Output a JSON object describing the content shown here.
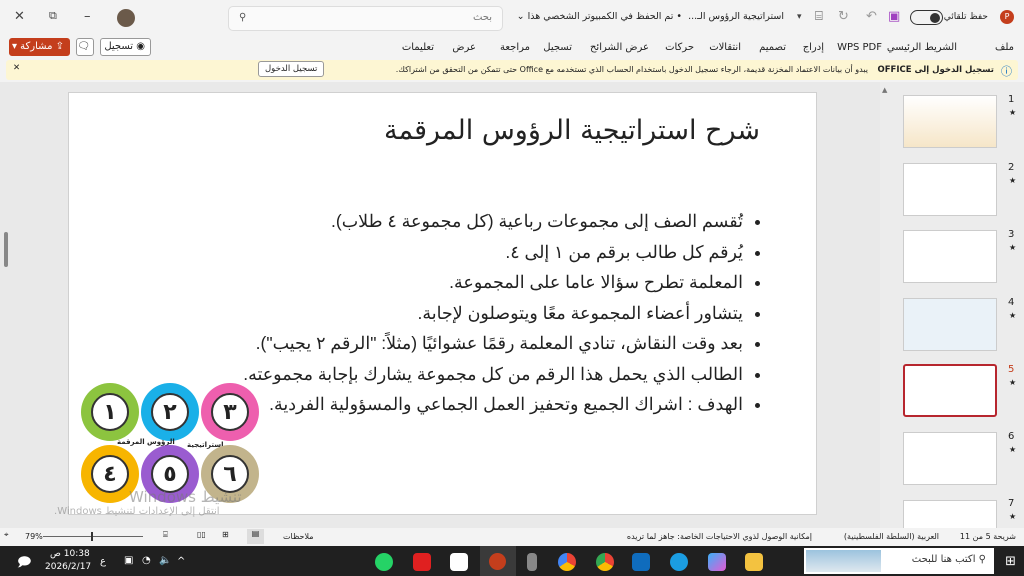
{
  "titlebar": {
    "app_icon": "powerpoint-icon",
    "autosave_label": "حفظ تلقائي",
    "file_title": "استراتيجية الرؤوس الـ...",
    "save_status": "• تم الحفظ في الكمبيوتر الشخصي هذا",
    "search_placeholder": "بحث"
  },
  "ribbon": {
    "tabs": [
      "ملف",
      "الشريط الرئيسي",
      "WPS PDF",
      "إدراج",
      "تصميم",
      "انتقالات",
      "حركات",
      "عرض الشرائح",
      "تسجيل",
      "مراجعة",
      "عرض",
      "تعليمات"
    ],
    "record_button": "تسجيل",
    "share_button": "مشاركة"
  },
  "notification": {
    "title": "تسجيل الدخول إلى OFFICE",
    "message": "يبدو أن بيانات الاعتماد المخزنة قديمة، الرجاء تسجيل الدخول باستخدام الحساب الذي تستخدمه مع Office حتى تتمكن من التحقق من اشتراكك.",
    "button": "تسجيل الدخول"
  },
  "slide": {
    "title": "شرح استراتيجية الرؤوس المرقمة",
    "bullets": [
      "تُقسم  الصف إلى مجموعات رباعية (كل مجموعة ٤ طلاب).",
      "يُرقم  كل طالب برقم من ١ إلى ٤.",
      "المعلمة تطرح سؤالا عاما على المجموعة.",
      "يتشاور أعضاء المجموعة معًا ويتوصلون لإجابة.",
      "بعد وقت النقاش، تنادي المعلمة رقمًا عشوائيًا (مثلاً: \"الرقم ٢ يجيب\").",
      "الطالب الذي يحمل هذا الرقم من كل مجموعة يشارك بإجابة مجموعته.",
      "الهدف : اشراك الجميع وتحفيز العمل الجماعي والمسؤولية الفردية."
    ],
    "badges": [
      {
        "num": "١",
        "color": "#8cc43f"
      },
      {
        "num": "٢",
        "color": "#1ab0e8"
      },
      {
        "num": "٣",
        "color": "#ee5fae"
      },
      {
        "num": "٤",
        "color": "#f7b500"
      },
      {
        "num": "٥",
        "color": "#9a5cd0"
      },
      {
        "num": "٦",
        "color": "#c2b48c"
      }
    ],
    "badge_label_1": "الرؤوس المرقمة",
    "badge_label_2": "استراتيجية",
    "watermark_1": "تنشيط Windows",
    "watermark_2": "انتقل إلى الإعدادات لتنشيط Windows."
  },
  "thumbnails": [
    {
      "num": "1"
    },
    {
      "num": "2"
    },
    {
      "num": "3"
    },
    {
      "num": "4"
    },
    {
      "num": "5",
      "selected": true
    },
    {
      "num": "6"
    },
    {
      "num": "7"
    }
  ],
  "status": {
    "slide_info": "شريحة 5 من 11",
    "language": "العربية (السلطة الفلسطينية)",
    "accessibility": "إمكانية الوصول لذوي الاحتياجات الخاصة: جاهز لما تريده",
    "notes": "ملاحظات",
    "zoom": "79%",
    "zoom_fraction": 0.55
  },
  "taskbar": {
    "search_placeholder": "اكتب هنا للبحث",
    "time": "10:38 ص",
    "date": "2026/2/17",
    "lang": "ع"
  }
}
